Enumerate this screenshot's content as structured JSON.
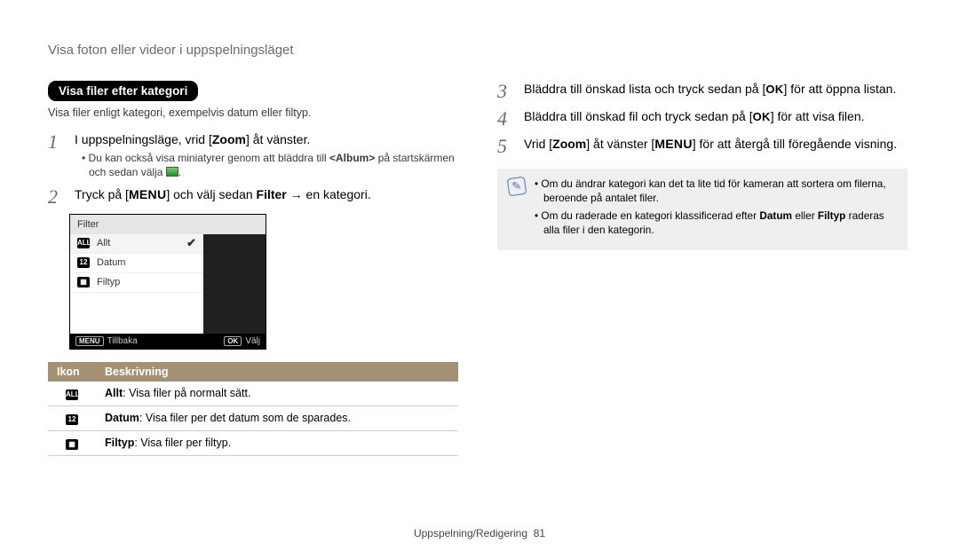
{
  "page_title": "Visa foton eller videor i uppspelningsläget",
  "pill_heading": "Visa filer efter kategori",
  "subtext": "Visa filer enligt kategori, exempelvis datum eller filtyp.",
  "steps_left": {
    "s1": {
      "num": "1",
      "text_a": "I uppspelningsläge, vrid [",
      "zoom": "Zoom",
      "text_b": "] åt vänster.",
      "bullet_a": "Du kan också visa miniatyrer genom att bläddra till ",
      "bullet_bold": "<Album>",
      "bullet_b": " på startskärmen och sedan välja ",
      "bullet_c": "."
    },
    "s2": {
      "num": "2",
      "text_a": "Tryck på [",
      "menu": "MENU",
      "text_b": "] och välj sedan ",
      "filter": "Filter",
      "arrow": " → en kategori."
    }
  },
  "cam": {
    "header": "Filter",
    "items": [
      "Allt",
      "Datum",
      "Filtyp"
    ],
    "footer_menu": "MENU",
    "footer_back": "Tillbaka",
    "footer_ok": "OK",
    "footer_select": "Välj"
  },
  "table": {
    "h1": "Ikon",
    "h2": "Beskrivning",
    "rows": [
      {
        "icon": "ALL",
        "bold": "Allt",
        "text": ": Visa filer på normalt sätt."
      },
      {
        "icon": "12",
        "bold": "Datum",
        "text": ": Visa filer per det datum som de sparades."
      },
      {
        "icon": "▦",
        "bold": "Filtyp",
        "text": ": Visa filer per filtyp."
      }
    ]
  },
  "steps_right": {
    "s3": {
      "num": "3",
      "a": "Bläddra till önskad lista och tryck sedan på [",
      "ok": "OK",
      "b": "] för att öppna listan."
    },
    "s4": {
      "num": "4",
      "a": "Bläddra till önskad fil och tryck sedan på [",
      "ok": "OK",
      "b": "] för att visa filen."
    },
    "s5": {
      "num": "5",
      "a": "Vrid [",
      "zoom": "Zoom",
      "b": "] åt vänster [",
      "menu": "MENU",
      "c": "] för att återgå till föregående visning."
    }
  },
  "note": {
    "n1a": "Om du ändrar kategori kan det ta lite tid för kameran att sortera om filerna, beroende på antalet filer.",
    "n2a": "Om du raderade en kategori klassificerad efter ",
    "n2bold1": "Datum",
    "n2mid": " eller ",
    "n2bold2": "Filtyp",
    "n2b": " raderas alla filer i den kategorin."
  },
  "footer": {
    "section": "Uppspelning/Redigering",
    "page": "81"
  }
}
